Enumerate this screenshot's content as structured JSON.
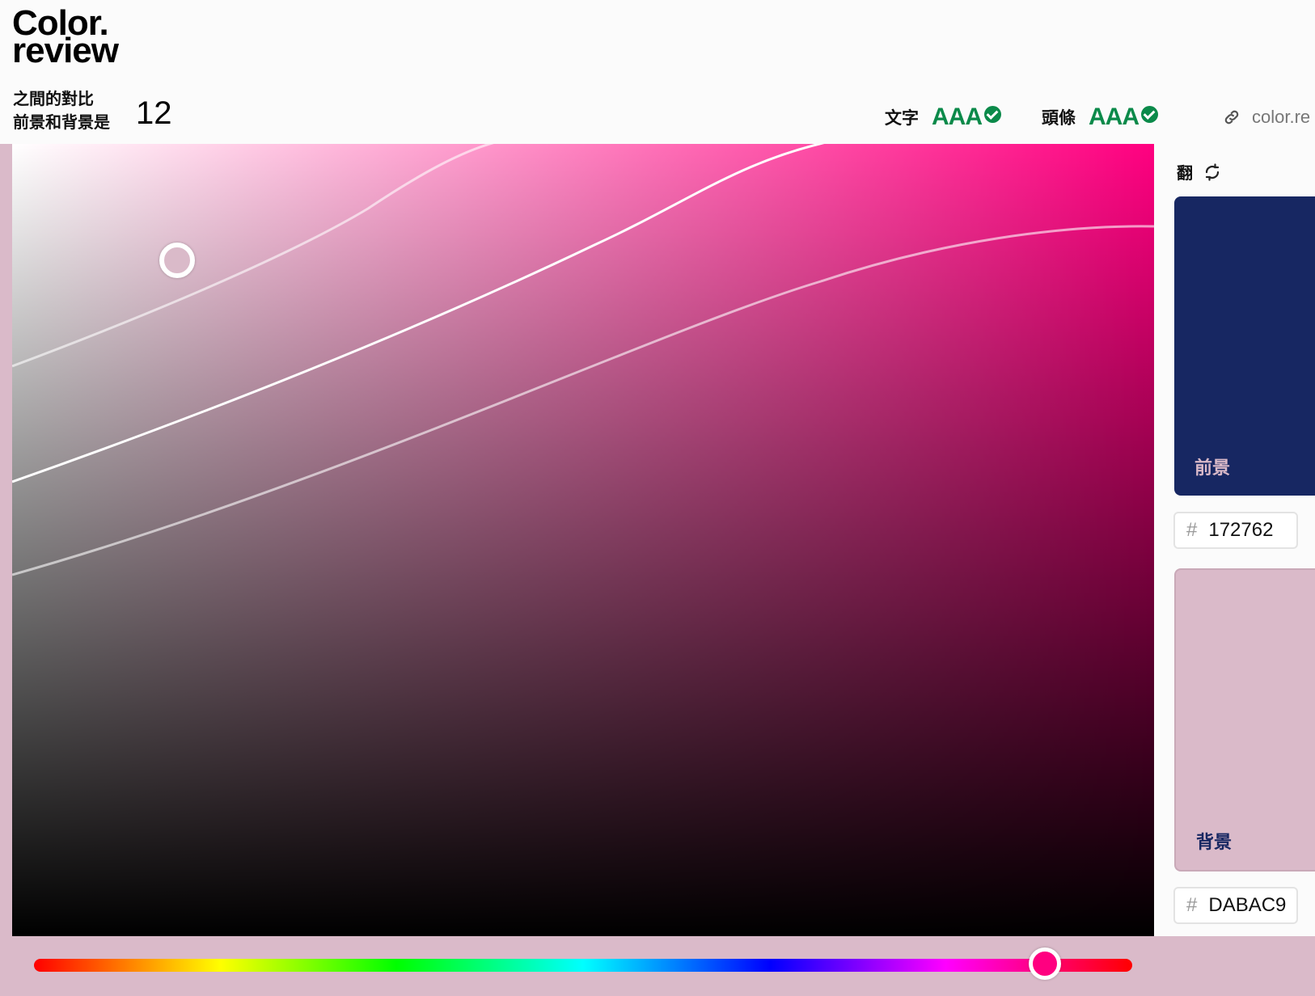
{
  "header": {
    "logo_line1": "Color.",
    "logo_line2": "review",
    "contrast_label_line1": "之間的對比",
    "contrast_label_line2": "前景和背景是",
    "contrast_value": "12",
    "text_rating_label": "文字",
    "text_rating_level": "AAA",
    "heading_rating_label": "頭條",
    "heading_rating_level": "AAA",
    "share_link_text": "color.re"
  },
  "side_panel": {
    "flip_label": "翻",
    "foreground_label": "前景",
    "foreground_hex": "172762",
    "background_label": "背景",
    "background_hex": "DABAC9",
    "hash_symbol": "#"
  },
  "picker": {
    "hue_color": "#ff0080",
    "hue_fraction": 0.91,
    "saturation_fraction": 0.14,
    "brightness_fraction": 0.86
  },
  "colors": {
    "foreground": "#172762",
    "background": "#dabac9",
    "pass_green": "#0b8a4a"
  },
  "icons": {
    "rating_check": "check-circle-icon",
    "link": "link-icon",
    "flip": "refresh-icon"
  }
}
